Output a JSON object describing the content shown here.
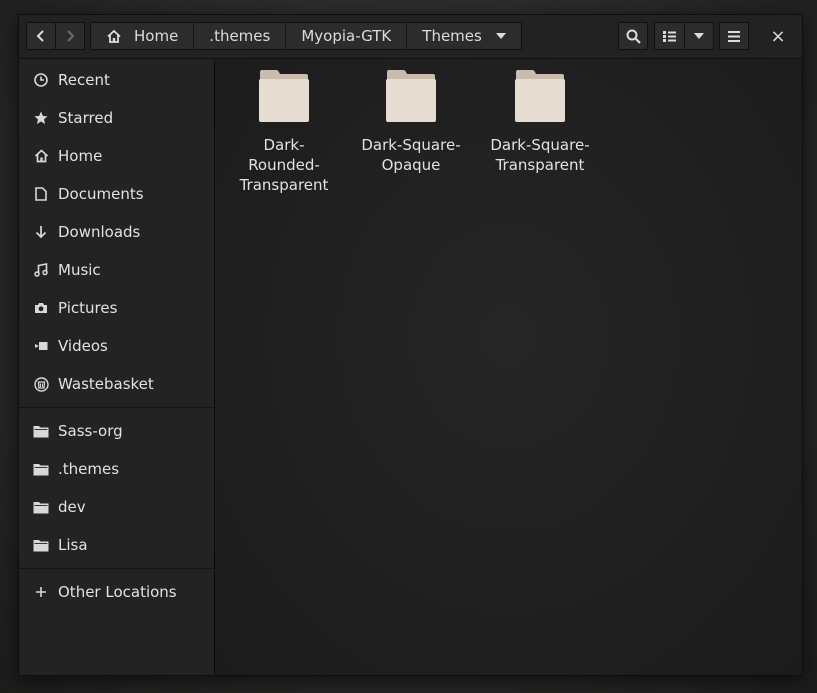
{
  "header": {
    "breadcrumbs": [
      "Home",
      ".themes",
      "Myopia-GTK",
      "Themes"
    ],
    "buttons": {
      "back": "back-icon",
      "forward": "forward-icon",
      "search": "search-icon",
      "view": "list-view-icon",
      "view_options": "chevron-down-icon",
      "menu": "hamburger-menu-icon",
      "close": "×"
    }
  },
  "sidebar": {
    "places": [
      {
        "label": "Recent",
        "icon": "clock-icon"
      },
      {
        "label": "Starred",
        "icon": "star-icon"
      },
      {
        "label": "Home",
        "icon": "home-icon"
      },
      {
        "label": "Documents",
        "icon": "document-icon"
      },
      {
        "label": "Downloads",
        "icon": "download-icon"
      },
      {
        "label": "Music",
        "icon": "music-icon"
      },
      {
        "label": "Pictures",
        "icon": "camera-icon"
      },
      {
        "label": "Videos",
        "icon": "video-icon"
      },
      {
        "label": "Wastebasket",
        "icon": "trash-icon"
      }
    ],
    "bookmarks": [
      {
        "label": "Sass-org",
        "icon": "folder-icon"
      },
      {
        "label": ".themes",
        "icon": "folder-icon"
      },
      {
        "label": "dev",
        "icon": "folder-icon"
      },
      {
        "label": "Lisa",
        "icon": "folder-icon"
      }
    ],
    "other": {
      "label": "Other Locations",
      "icon": "plus-icon"
    }
  },
  "files": [
    {
      "name": "Dark-Rounded-Transparent",
      "lines": [
        "Dark-",
        "Rounded-",
        "Transparent"
      ]
    },
    {
      "name": "Dark-Square-Opaque",
      "lines": [
        "Dark-Square-",
        "Opaque"
      ]
    },
    {
      "name": "Dark-Square-Transparent",
      "lines": [
        "Dark-Square-",
        "Transparent"
      ]
    }
  ],
  "colors": {
    "folder": "#e6dcd1",
    "folder_tab": "#c9bcad",
    "accent_text": "#e2e2e2"
  }
}
